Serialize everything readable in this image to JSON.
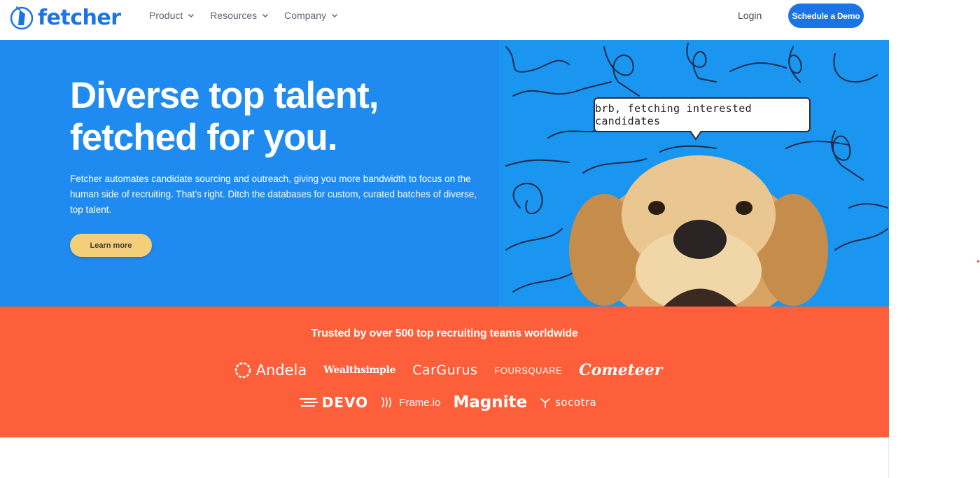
{
  "brand": {
    "logo_text": "fetcher",
    "accent": "#1b74e4"
  },
  "nav": {
    "items": [
      {
        "label": "Product"
      },
      {
        "label": "Resources"
      },
      {
        "label": "Company"
      }
    ],
    "login": "Login",
    "cta": "Schedule a Demo"
  },
  "hero": {
    "title_line1": "Diverse top talent,",
    "title_line2": "fetched for you.",
    "description": "Fetcher automates candidate sourcing and outreach, giving you more bandwidth to focus on the human side of recruiting. That’s right. Ditch the databases for custom, curated batches of diverse, top talent.",
    "button": "Learn more",
    "bubble": "brb, fetching interested candidates",
    "bg_left": "#1f8bf1",
    "bg_right": "#1a96f0"
  },
  "trusted": {
    "title": "Trusted by over 500 top recruiting teams worldwide",
    "bg": "#fd5f3a",
    "row1": [
      "Andela",
      "Wealthsimple",
      "CarGurus",
      "FOURSQUARE",
      "Cometeer"
    ],
    "row2": [
      "DEVO",
      "Frame.io",
      "Magnite",
      "socotra"
    ]
  }
}
